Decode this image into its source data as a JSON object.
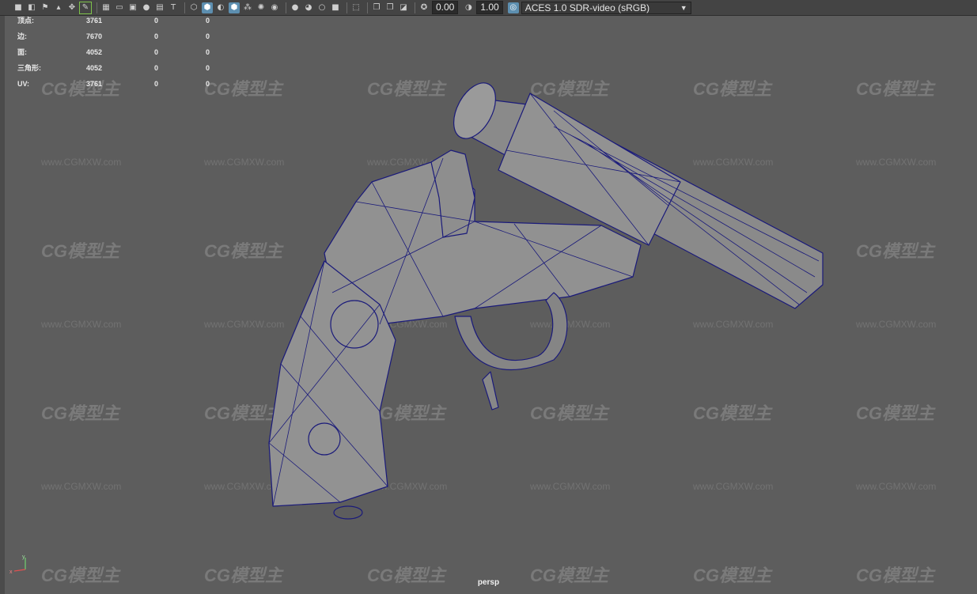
{
  "toolbar": {
    "exposure_value": "0.00",
    "gamma_value": "1.00",
    "color_space": "ACES 1.0 SDR-video (sRGB)",
    "icons": [
      "camera-icon",
      "camera-attributes-icon",
      "bookmark-icon",
      "image-plane-icon",
      "grease-pencil-icon",
      "2d-pan-zoom-icon",
      "move-camera-icon",
      "grid-icon",
      "film-gate-icon",
      "resolution-gate-icon",
      "gate-mask-icon",
      "field-chart-icon",
      "safe-action-icon",
      "safe-title-icon",
      "wireframe-icon",
      "smooth-shade-icon",
      "default-material-icon",
      "wireframe-on-shaded-icon",
      "xray-icon",
      "use-all-lights-icon",
      "shadows-icon",
      "screen-space-ao-icon",
      "motion-blur-icon",
      "anti-aliasing-icon",
      "depth-of-field-icon",
      "isolate-select-icon",
      "xray-joints-icon",
      "xray-active-icon",
      "backface-culling-icon",
      "exposure-icon",
      "gamma-icon",
      "color-management-icon"
    ]
  },
  "stats": {
    "rows": [
      {
        "label": "顶点:",
        "v1": "3761",
        "v2": "0",
        "v3": "0"
      },
      {
        "label": "边:",
        "v1": "7670",
        "v2": "0",
        "v3": "0"
      },
      {
        "label": "面:",
        "v1": "4052",
        "v2": "0",
        "v3": "0"
      },
      {
        "label": "三角形:",
        "v1": "4052",
        "v2": "0",
        "v3": "0"
      },
      {
        "label": "UV:",
        "v1": "3761",
        "v2": "0",
        "v3": "0"
      }
    ]
  },
  "viewport": {
    "camera_label": "persp",
    "axis_x": "x",
    "axis_y": "y"
  },
  "watermark": {
    "logo_text": "CG模型主",
    "url_text": "www.CGMXW.com"
  },
  "colors": {
    "viewport_bg": "#5d5d5d",
    "toolbar_bg": "#444444",
    "wireframe": "#1a1a7a",
    "model_fill": "#8a8a8a",
    "active_icon": "#5d8fb0"
  }
}
